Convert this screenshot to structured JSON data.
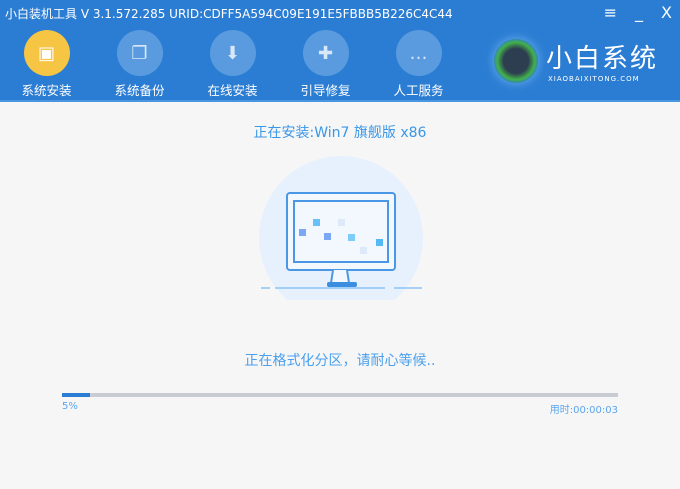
{
  "window": {
    "title": "小白装机工具 V 3.1.572.285 URID:CDFF5A594C09E191E5FBBB5B226C4C44",
    "menu_icon": "menu-icon",
    "minimize": "_",
    "close": "X"
  },
  "nav": [
    {
      "label": "系统安装",
      "icon": "install-icon",
      "active": true
    },
    {
      "label": "系统备份",
      "icon": "backup-icon"
    },
    {
      "label": "在线安装",
      "icon": "download-icon"
    },
    {
      "label": "引导修复",
      "icon": "toolbox-icon"
    },
    {
      "label": "人工服务",
      "icon": "chat-icon"
    }
  ],
  "logo": {
    "name": "小白系统",
    "url": "XIAOBAIXITONG.COM"
  },
  "status": "正在安装:Win7 旗舰版 x86",
  "message": "正在格式化分区，请耐心等候..",
  "progress": {
    "percent": 5,
    "label": "5%",
    "elapsed": "用时:00:00:03"
  }
}
